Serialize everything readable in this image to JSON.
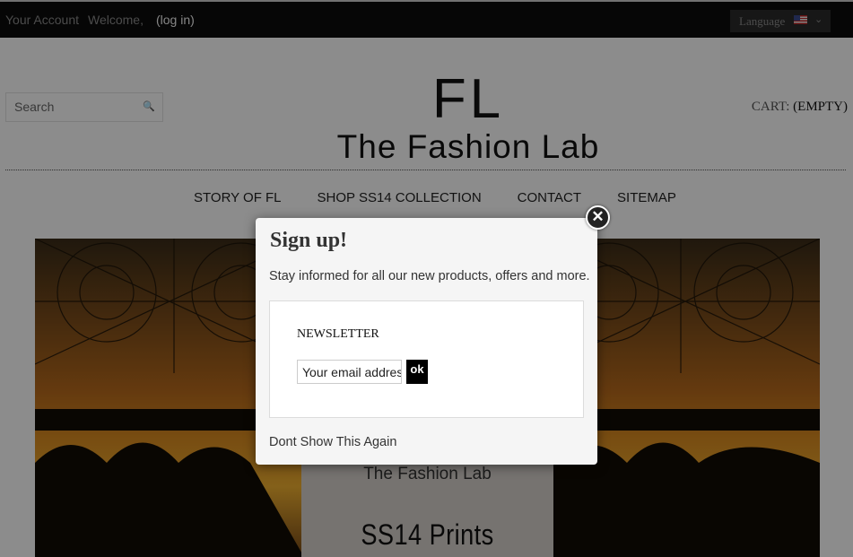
{
  "topbar": {
    "account": "Your Account",
    "welcome": "Welcome,",
    "login": "(log in)",
    "language": "Language",
    "language_flag": "us-flag-icon"
  },
  "header": {
    "search_placeholder": "Search",
    "logo_mark": "FL",
    "logo_name": "The Fashion Lab",
    "cart_label": "CART:",
    "cart_status": "(EMPTY)"
  },
  "nav": {
    "items": [
      "STORY OF FL",
      "SHOP SS14 COLLECTION",
      "CONTACT",
      "SITEMAP"
    ]
  },
  "banner": {
    "card_name": "The Fashion Lab",
    "card_title": "SS14 Prints"
  },
  "modal": {
    "title": "Sign up!",
    "description": "Stay informed for all our new products, offers and more.",
    "newsletter_label": "NEWSLETTER",
    "email_value": "Your email address",
    "ok_label": "ok",
    "dont_show": "Dont Show This Again",
    "close_icon": "close-icon"
  }
}
